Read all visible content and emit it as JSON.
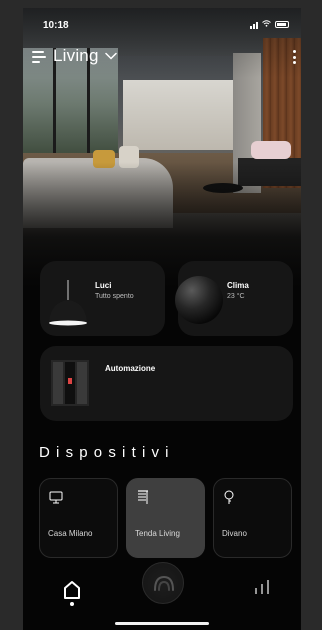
{
  "status_bar": {
    "time": "10:18"
  },
  "header": {
    "room_title": "Living"
  },
  "cards": {
    "luci": {
      "title": "Luci",
      "status": "Tutto spento"
    },
    "clima": {
      "title": "Clima",
      "status": "23 °C"
    },
    "automazione": {
      "title": "Automazione"
    }
  },
  "devices_section": {
    "title": "Dispositivi"
  },
  "devices": [
    {
      "label": "Casa Milano",
      "icon": "monitor-icon",
      "selected": false
    },
    {
      "label": "Tenda Living",
      "icon": "blinds-icon",
      "selected": true
    },
    {
      "label": "Divano",
      "icon": "lightbulb-icon",
      "selected": false
    }
  ],
  "bottom_nav": {
    "items": [
      "home-icon",
      "center-control-icon",
      "stats-icon"
    ],
    "active": "home-icon"
  },
  "colors": {
    "background": "#050505",
    "card": "#161616",
    "selected_device": "#3f3f3f",
    "text": "#ffffff",
    "secondary_text": "#bdbdbd"
  }
}
